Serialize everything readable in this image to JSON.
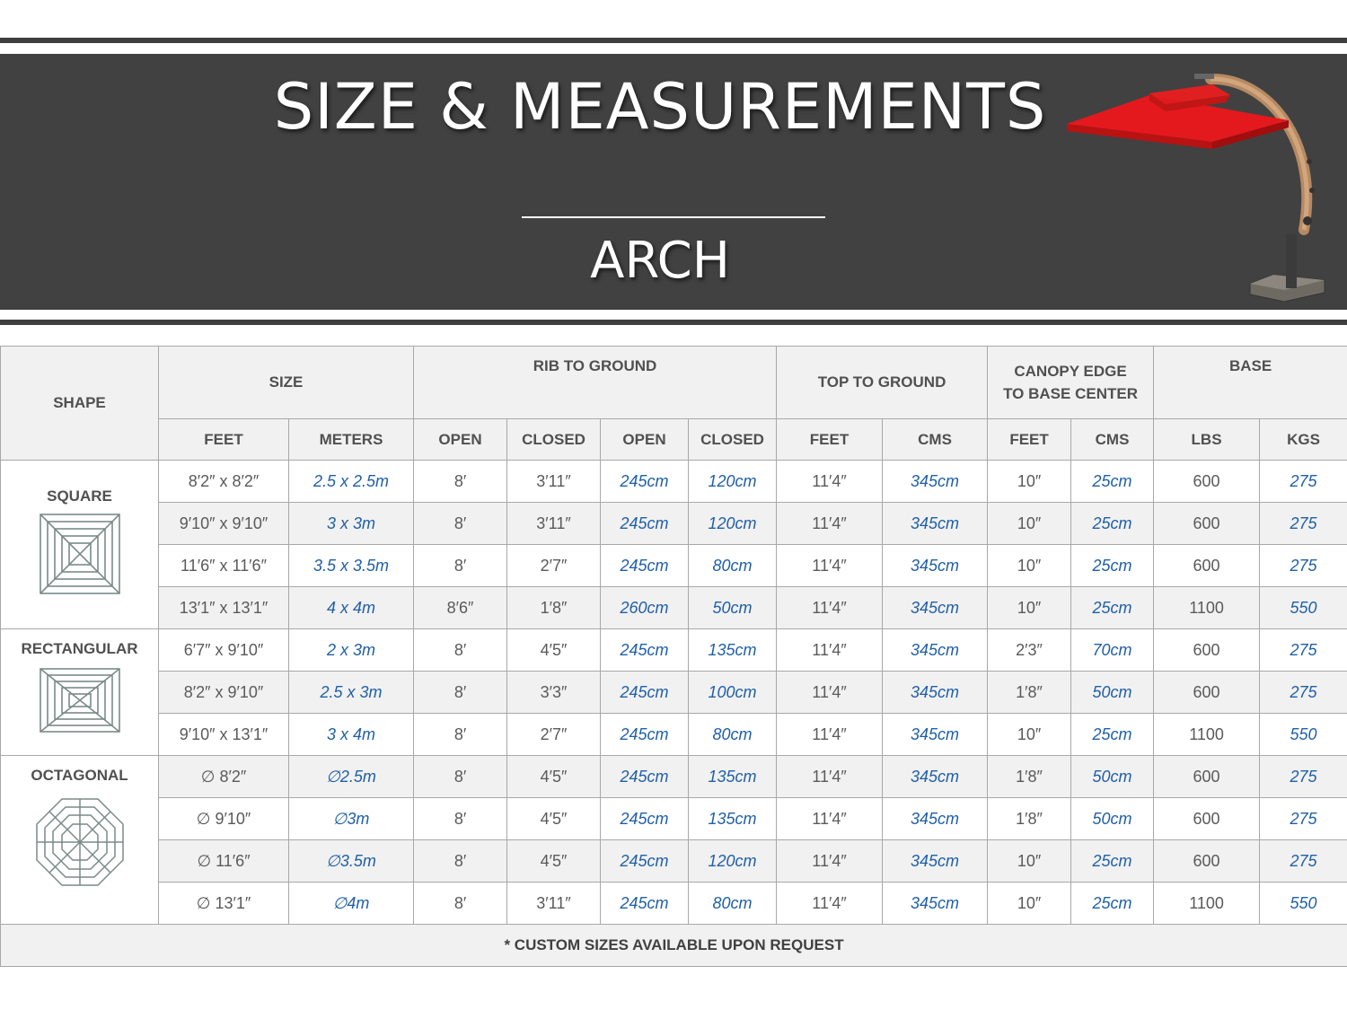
{
  "header": {
    "title": "SIZE & MEASUREMENTS",
    "subtitle": "ARCH"
  },
  "colors": {
    "banner": "#414141",
    "metric_text": "#1f5fa8",
    "canopy": "#e02020",
    "row_alt": "#f1f1f1"
  },
  "table": {
    "group_headers": {
      "shape": "SHAPE",
      "size": "SIZE",
      "rib_to_ground": "RIB TO GROUND",
      "top_to_ground": "TOP TO GROUND",
      "canopy_edge_line1": "CANOPY EDGE",
      "canopy_edge_line2": "TO BASE CENTER",
      "base": "BASE"
    },
    "sub_headers": [
      "FEET",
      "METERS",
      "OPEN",
      "CLOSED",
      "OPEN",
      "CLOSED",
      "FEET",
      "CMS",
      "FEET",
      "CMS",
      "LBS",
      "KGS"
    ],
    "shapes": [
      {
        "name": "SQUARE",
        "icon": "square-canopy-icon"
      },
      {
        "name": "RECTANGULAR",
        "icon": "rectangular-canopy-icon"
      },
      {
        "name": "OCTAGONAL",
        "icon": "octagonal-canopy-icon"
      }
    ],
    "rows": [
      [
        "8′2″ x 8′2″",
        "2.5 x 2.5m",
        "8′",
        "3′11″",
        "245cm",
        "120cm",
        "11′4″",
        "345cm",
        "10″",
        "25cm",
        "600",
        "275"
      ],
      [
        "9′10″ x 9′10″",
        "3 x 3m",
        "8′",
        "3′11″",
        "245cm",
        "120cm",
        "11′4″",
        "345cm",
        "10″",
        "25cm",
        "600",
        "275"
      ],
      [
        "11′6″ x 11′6″",
        "3.5 x 3.5m",
        "8′",
        "2′7″",
        "245cm",
        "80cm",
        "11′4″",
        "345cm",
        "10″",
        "25cm",
        "600",
        "275"
      ],
      [
        "13′1″ x 13′1″",
        "4 x 4m",
        "8′6″",
        "1′8″",
        "260cm",
        "50cm",
        "11′4″",
        "345cm",
        "10″",
        "25cm",
        "1100",
        "550"
      ],
      [
        "6′7″ x 9′10″",
        "2 x 3m",
        "8′",
        "4′5″",
        "245cm",
        "135cm",
        "11′4″",
        "345cm",
        "2′3″",
        "70cm",
        "600",
        "275"
      ],
      [
        "8′2″ x 9′10″",
        "2.5 x 3m",
        "8′",
        "3′3″",
        "245cm",
        "100cm",
        "11′4″",
        "345cm",
        "1′8″",
        "50cm",
        "600",
        "275"
      ],
      [
        "9′10″ x 13′1″",
        "3 x 4m",
        "8′",
        "2′7″",
        "245cm",
        "80cm",
        "11′4″",
        "345cm",
        "10″",
        "25cm",
        "1100",
        "550"
      ],
      [
        "∅ 8′2″",
        "∅2.5m",
        "8′",
        "4′5″",
        "245cm",
        "135cm",
        "11′4″",
        "345cm",
        "1′8″",
        "50cm",
        "600",
        "275"
      ],
      [
        "∅ 9′10″",
        "∅3m",
        "8′",
        "4′5″",
        "245cm",
        "135cm",
        "11′4″",
        "345cm",
        "1′8″",
        "50cm",
        "600",
        "275"
      ],
      [
        "∅ 11′6″",
        "∅3.5m",
        "8′",
        "4′5″",
        "245cm",
        "120cm",
        "11′4″",
        "345cm",
        "10″",
        "25cm",
        "600",
        "275"
      ],
      [
        "∅ 13′1″",
        "∅4m",
        "8′",
        "3′11″",
        "245cm",
        "80cm",
        "11′4″",
        "345cm",
        "10″",
        "25cm",
        "1100",
        "550"
      ]
    ],
    "footer": "* CUSTOM SIZES AVAILABLE UPON REQUEST"
  }
}
